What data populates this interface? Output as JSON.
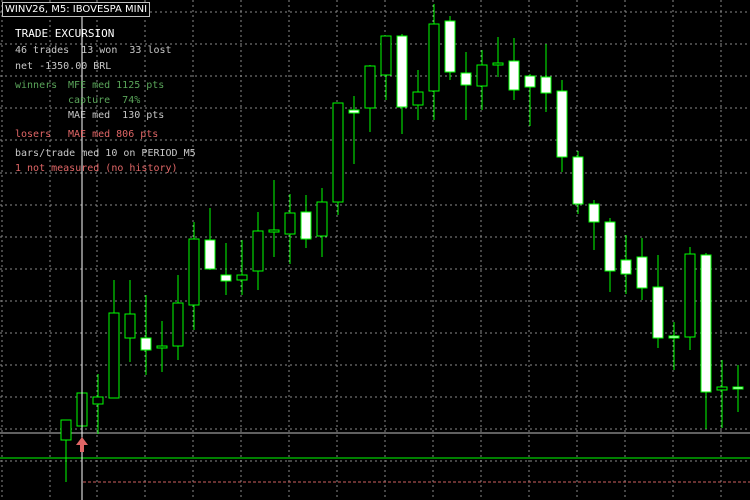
{
  "window": {
    "title": "WINV26, M5:  IBOVESPA MINI"
  },
  "panel": {
    "heading": "TRADE EXCURSION",
    "trades_line": "46 trades  13 won  33 lost",
    "net_line": "net -1350.00 BRL",
    "winners_label": "winners",
    "winners_mfe": "MFE med 1125 pts",
    "capture": "capture  74%",
    "winners_mae": "MAE med  130 pts",
    "losers_label": "losers",
    "losers_mae": "MAE med 806 pts",
    "bars_line": "bars/trade med 10 on PERIOD_M5",
    "not_measured": "1 not measured (no history)"
  },
  "colors": {
    "background": "#000000",
    "grid": "#8a8a8a",
    "bull_candle": "#000000",
    "bear_candle": "#ffffff",
    "candle_outline": "#00ff00",
    "wick": "#00ff00",
    "price_line": "#00ff00",
    "ask_line": "#d06060",
    "bid_line": "#c0c0c0",
    "label_grey": "#c8c8c8",
    "label_green": "#5aa55a",
    "label_red": "#e06666",
    "heading": "#ffffff",
    "arrow": "#e06666",
    "crosshair": "#ffffff"
  },
  "chart_data": {
    "type": "candlestick",
    "candles": [
      {
        "o": 50,
        "h": 40,
        "l": 8,
        "c": 70
      },
      {
        "o": 64,
        "h": 125,
        "l": 25,
        "c": 97
      },
      {
        "o": 86,
        "h": 116,
        "l": 56,
        "c": 93
      },
      {
        "o": 92,
        "h": 210,
        "l": 92,
        "c": 177
      },
      {
        "o": 152,
        "h": 210,
        "l": 128,
        "c": 176
      },
      {
        "o": 152,
        "h": 195,
        "l": 115,
        "c": 140
      },
      {
        "o": 142,
        "h": 169,
        "l": 118,
        "c": 144
      },
      {
        "o": 144,
        "h": 215,
        "l": 130,
        "c": 187
      },
      {
        "o": 185,
        "h": 268,
        "l": 160,
        "c": 251
      },
      {
        "o": 250,
        "h": 282,
        "l": 220,
        "c": 221
      },
      {
        "o": 215,
        "h": 247,
        "l": 195,
        "c": 209
      },
      {
        "o": 210,
        "h": 250,
        "l": 195,
        "c": 215
      },
      {
        "o": 219,
        "h": 278,
        "l": 200,
        "c": 259
      },
      {
        "o": 258,
        "h": 310,
        "l": 233,
        "c": 260
      },
      {
        "o": 256,
        "h": 296,
        "l": 226,
        "c": 277
      },
      {
        "o": 278,
        "h": 295,
        "l": 242,
        "c": 251
      },
      {
        "o": 254,
        "h": 302,
        "l": 233,
        "c": 288
      },
      {
        "o": 288,
        "h": 385,
        "l": 275,
        "c": 387
      },
      {
        "o": 380,
        "h": 394,
        "l": 326,
        "c": 377
      },
      {
        "o": 382,
        "h": 425,
        "l": 358,
        "c": 424
      },
      {
        "o": 415,
        "h": 450,
        "l": 390,
        "c": 454
      },
      {
        "o": 454,
        "h": 456,
        "l": 356,
        "c": 383
      },
      {
        "o": 385,
        "h": 420,
        "l": 370,
        "c": 398
      },
      {
        "o": 399,
        "h": 486,
        "l": 370,
        "c": 466
      },
      {
        "o": 469,
        "h": 474,
        "l": 410,
        "c": 418
      },
      {
        "o": 417,
        "h": 438,
        "l": 370,
        "c": 405
      },
      {
        "o": 404,
        "h": 440,
        "l": 380,
        "c": 425
      },
      {
        "o": 425,
        "h": 453,
        "l": 413,
        "c": 427
      },
      {
        "o": 429,
        "h": 452,
        "l": 390,
        "c": 400
      },
      {
        "o": 414,
        "h": 416,
        "l": 364,
        "c": 403
      },
      {
        "o": 413,
        "h": 446,
        "l": 378,
        "c": 397
      },
      {
        "o": 399,
        "h": 410,
        "l": 318,
        "c": 333
      },
      {
        "o": 333,
        "h": 339,
        "l": 276,
        "c": 286
      },
      {
        "o": 286,
        "h": 290,
        "l": 240,
        "c": 268
      },
      {
        "o": 268,
        "h": 272,
        "l": 198,
        "c": 219
      },
      {
        "o": 230,
        "h": 255,
        "l": 196,
        "c": 216
      },
      {
        "o": 233,
        "h": 252,
        "l": 190,
        "c": 202
      },
      {
        "o": 203,
        "h": 235,
        "l": 142,
        "c": 152
      },
      {
        "o": 154,
        "h": 168,
        "l": 120,
        "c": 152
      },
      {
        "o": 153,
        "h": 243,
        "l": 140,
        "c": 236
      },
      {
        "o": 235,
        "h": 237,
        "l": 61,
        "c": 98
      },
      {
        "o": 100,
        "h": 130,
        "l": 62,
        "c": 103
      },
      {
        "o": 103,
        "h": 125,
        "l": 78,
        "c": 101
      }
    ]
  }
}
